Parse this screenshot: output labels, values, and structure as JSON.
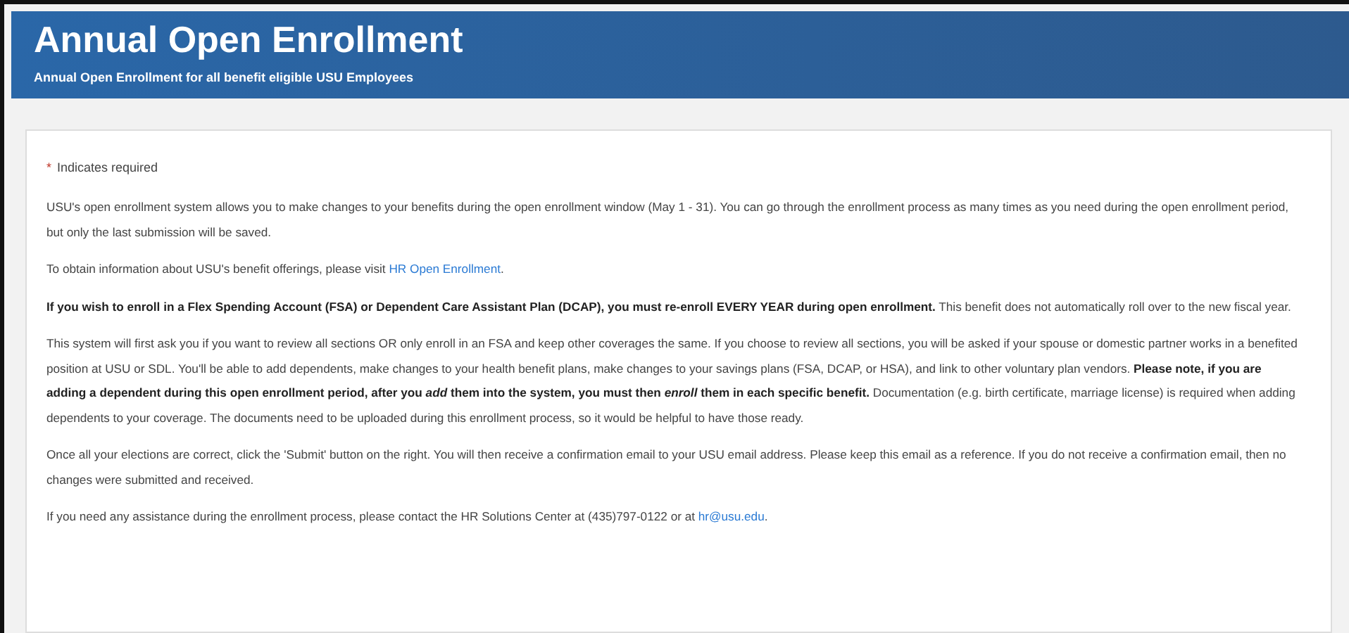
{
  "header": {
    "title": "Annual Open Enrollment",
    "subtitle": "Annual Open Enrollment for all benefit eligible USU Employees"
  },
  "required_note": {
    "mark": "*",
    "text": "Indicates required"
  },
  "paragraphs": [
    {
      "text": "USU's open enrollment system allows you to make changes to your benefits during the open enrollment window (May 1 - 31). You can go through the enrollment process as many times as you need during the open enrollment period, but only the last submission will be saved."
    },
    {
      "text": "To obtain information about USU's benefit offerings, please visit",
      "link": "HR Open Enrollment",
      "after": "."
    },
    {
      "text": "**If you wish to enroll in a Flex Spending Account (FSA) or Dependent Care Assistant Plan (DCAP), you must re-enroll EVERY YEAR during open enrollment.** This benefit does not automatically roll over to the new fiscal year."
    },
    {
      "text": "This system will first ask you if you want to review all sections OR only enroll in an FSA and keep other coverages the same. If you choose to review all sections, you will be asked if your spouse or domestic partner works in a benefited position at USU or SDL. You'll be able to add dependents, make changes to your health benefit plans, make changes to your savings plans (FSA, DCAP, or HSA), and link to other voluntary plan vendors. **Please note, if you are adding a dependent during this open enrollment period, after you *add* them into the system, you must then *enroll* them in each specific benefit.** Documentation (e.g. birth certificate, marriage license) is required when adding dependents to your coverage. The documents need to be uploaded during this enrollment process, so it would be helpful to have those ready."
    },
    {
      "text": "Once all your elections are correct, click the 'Submit' button on the right. You will then receive a confirmation email to your USU email address. Please keep this email as a reference. If you do not receive a confirmation email, then no changes were submitted and received."
    },
    {
      "text": "If you need any assistance during the enrollment process, please contact the HR Solutions Center at (435)797-0122 or at",
      "link": "hr@usu.edu",
      "after": "."
    }
  ]
}
